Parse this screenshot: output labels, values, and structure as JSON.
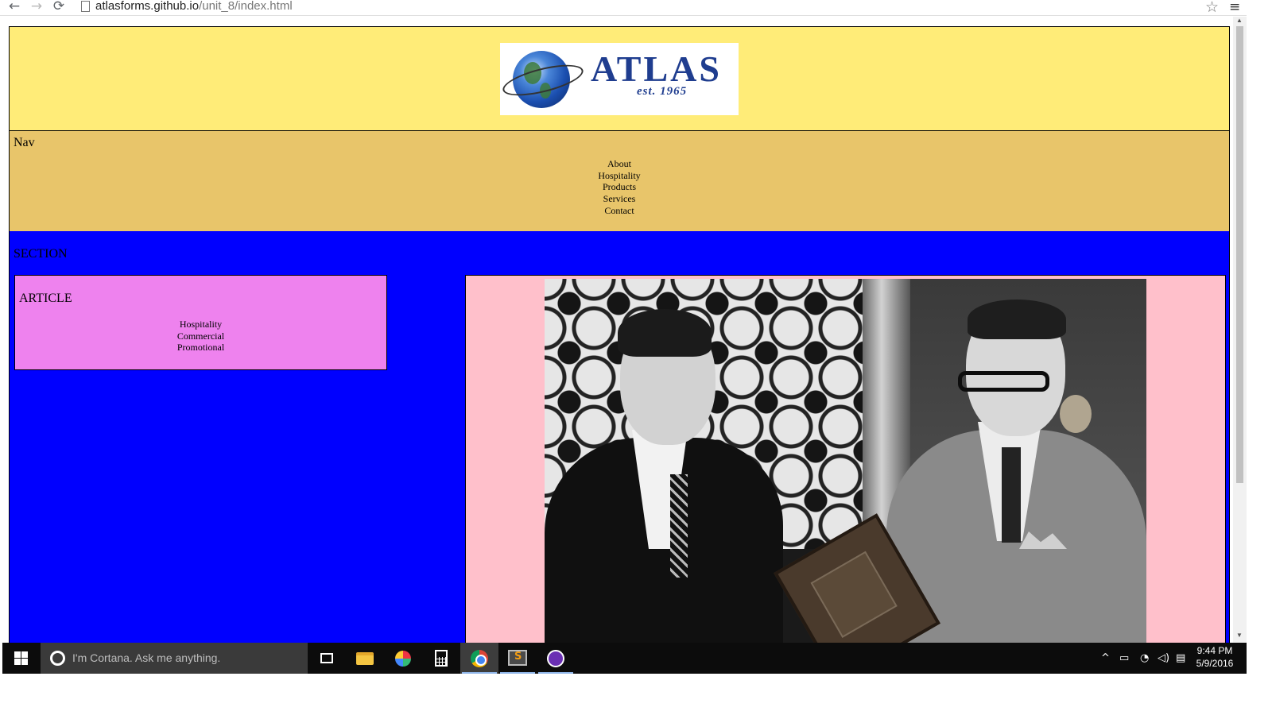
{
  "browser": {
    "url_host": "atlasforms.github.io",
    "url_path": "/unit_8/index.html",
    "back_icon": "←",
    "forward_icon": "→",
    "reload_icon": "⟳",
    "star_icon": "☆",
    "menu_icon": "≡"
  },
  "header": {
    "logo": {
      "word": "ATLAS",
      "tagline": "est. 1965"
    }
  },
  "nav": {
    "heading": "Nav",
    "items": [
      "About",
      "Hospitality",
      "Products",
      "Services",
      "Contact"
    ]
  },
  "section": {
    "heading": "SECTION",
    "article": {
      "heading": "ARTICLE",
      "items": [
        "Hospitality",
        "Commercial",
        "Promotional"
      ]
    }
  },
  "colors": {
    "header_bg": "#ffec78",
    "nav_bg": "#e8c56a",
    "section_bg": "#0000ff",
    "article_bg": "#ee82ee",
    "aside_bg": "#ffc0cb",
    "logo_text": "#1f3d8f"
  },
  "taskbar": {
    "search_placeholder": "I'm Cortana. Ask me anything.",
    "apps": [
      "task-view-icon",
      "file-explorer-icon",
      "paint-icon",
      "calculator-icon",
      "chrome-icon",
      "sublime-text-icon",
      "purple-app-icon"
    ],
    "active_app": "chrome-icon",
    "tray": {
      "chevron": "^",
      "battery_icon": "▭",
      "wifi_icon": "◔",
      "volume_icon": "◁)",
      "notification_icon": "▤"
    },
    "clock": {
      "time": "9:44 PM",
      "date": "5/9/2016"
    }
  }
}
